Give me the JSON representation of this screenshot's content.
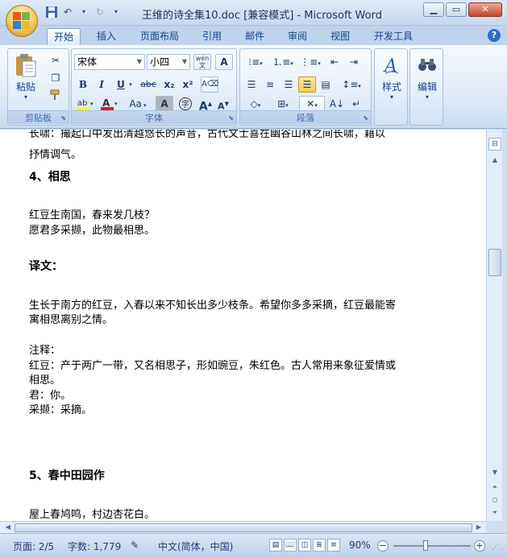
{
  "window": {
    "title": "王维的诗全集10.doc [兼容模式] - Microsoft Word"
  },
  "tabs": [
    "开始",
    "插入",
    "页面布局",
    "引用",
    "邮件",
    "审阅",
    "视图",
    "开发工具"
  ],
  "ribbon": {
    "clipboard": {
      "paste": "粘贴",
      "label": "剪贴板"
    },
    "font": {
      "name": "宋体",
      "size": "小四",
      "wen": "wén\n文",
      "a_box": "A",
      "bold": "B",
      "italic": "I",
      "underline": "U",
      "strike": "abc",
      "subscript": "x₂",
      "superscript": "x²",
      "aa": "Aa",
      "char_shade": "A",
      "enclose": "字",
      "grow": "A",
      "shrink": "A",
      "label": "字体"
    },
    "paragraph": {
      "label": "段落"
    },
    "styles": {
      "label": "样式"
    },
    "editing": {
      "label": "编辑"
    }
  },
  "document": {
    "lines": [
      "长啸：撮起口中发出清越悠长的声音，古代文士喜在幽谷山林之间长啸，藉以",
      "抒情调气。",
      "4、相思",
      "红豆生南国，春来发几枝？",
      "愿君多采撷，此物最相思。",
      "译文：",
      "生长于南方的红豆，入春以来不知长出多少枝条。希望你多多采摘，红豆最能寄",
      "寓相思离别之情。",
      "注释：",
      "红豆：产于两广一带，又名相思子，形如豌豆，朱红色。古人常用来象征爱情或",
      "相思。",
      "君：你。",
      "采撷：采摘。",
      "5、春中田园作",
      "屋上春鸠鸣，村边杏花白。"
    ]
  },
  "status": {
    "page": "页面: 2/5",
    "words": "字数: 1,779",
    "language": "中文(简体，中国)",
    "zoom": "90%",
    "zoom_value": 90
  }
}
